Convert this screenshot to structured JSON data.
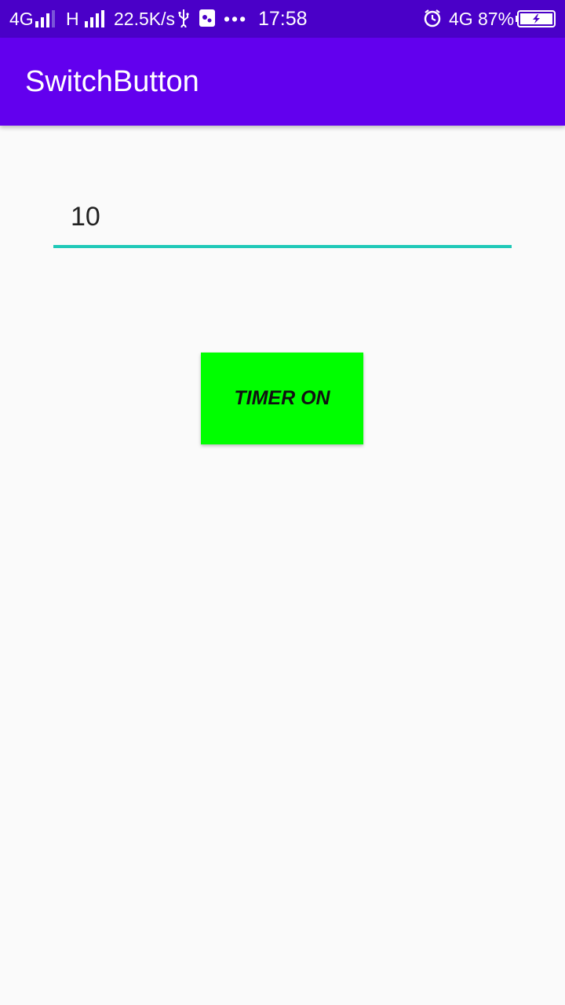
{
  "status_bar": {
    "network1": "4G",
    "network2": "H",
    "speed": "22.5K/s",
    "more": "•••",
    "time": "17:58",
    "network3": "4G",
    "battery": "87%",
    "icons": [
      "signal-icon",
      "usb-icon",
      "app-notification-icon",
      "alarm-icon",
      "battery-charging-icon"
    ]
  },
  "app_bar": {
    "title": "SwitchButton"
  },
  "timer_input": {
    "value": "10"
  },
  "timer_button": {
    "label": "TIMER ON",
    "background": "#00ff00"
  },
  "colors": {
    "status_bar": "#4a00c8",
    "app_bar": "#6200ee",
    "accent_underline": "#20c9b8",
    "background": "#fafafa"
  }
}
